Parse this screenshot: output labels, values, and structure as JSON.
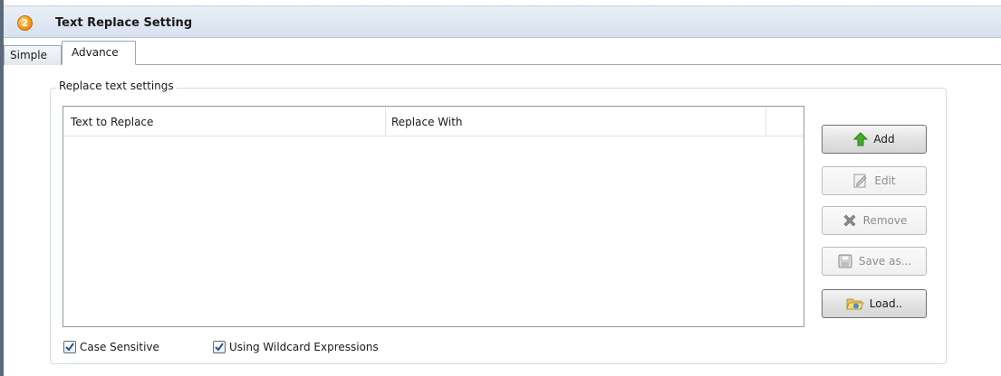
{
  "window": {
    "step_number": "2",
    "title": "Text Replace Setting"
  },
  "tabs": [
    {
      "label": "Simple",
      "selected": false
    },
    {
      "label": "Advance",
      "selected": true
    }
  ],
  "group": {
    "legend": "Replace text settings"
  },
  "list": {
    "columns": [
      "Text to Replace",
      "Replace With"
    ],
    "rows": []
  },
  "buttons": {
    "add": {
      "label": "Add",
      "icon": "green-up-arrow-icon",
      "enabled": true
    },
    "edit": {
      "label": "Edit",
      "icon": "edit-document-icon",
      "enabled": false
    },
    "remove": {
      "label": "Remove",
      "icon": "x-remove-icon",
      "enabled": false
    },
    "save_as": {
      "label": "Save as...",
      "icon": "floppy-disk-icon",
      "enabled": false
    },
    "load": {
      "label": "Load..",
      "icon": "folder-open-icon",
      "enabled": true
    }
  },
  "options": {
    "case_sensitive": {
      "label": "Case Sensitive",
      "checked": true
    },
    "wildcard": {
      "label": "Using Wildcard Expressions",
      "checked": true
    }
  },
  "colors": {
    "header_bg": "#dde5f0",
    "badge": "#f59a1b",
    "add_arrow": "#3fae2a"
  }
}
